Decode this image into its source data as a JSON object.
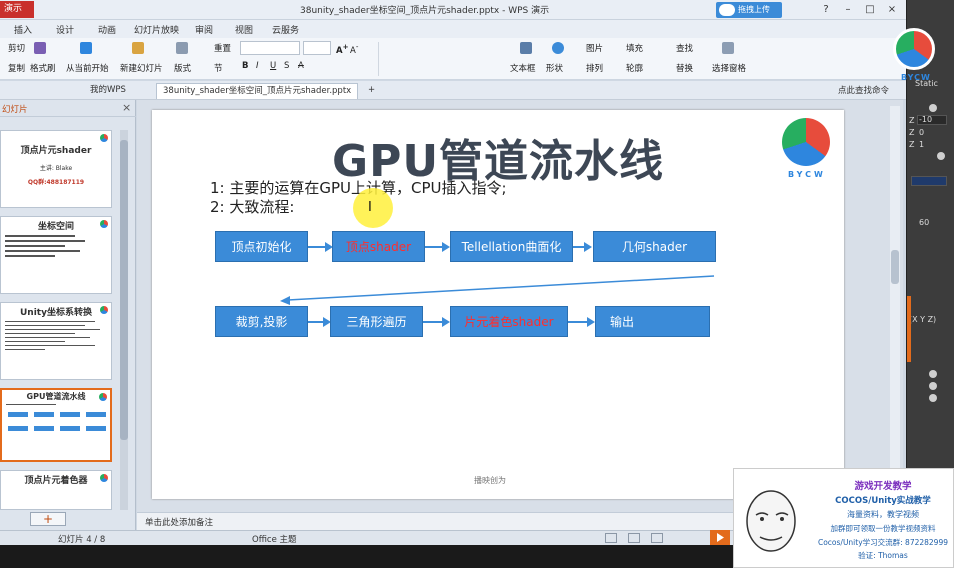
{
  "window": {
    "app_badge": "演示",
    "title": "38unity_shader坐标空间_顶点片元shader.pptx - WPS 演示",
    "upload_label": "拖拽上传",
    "controls": [
      "?",
      "–",
      "□",
      "×"
    ]
  },
  "menu": {
    "items": [
      "插入",
      "设计",
      "动画",
      "幻灯片放映",
      "审阅",
      "视图",
      "云服务"
    ]
  },
  "ribbon": {
    "cut": "剪切",
    "copy": "复制",
    "format_painter": "格式刷",
    "from_current": "从当前开始",
    "new_slide": "新建幻灯片",
    "layout": "版式",
    "section": "节",
    "reset": "重置",
    "text_box": "文本框",
    "shape": "形状",
    "picture": "图片",
    "fill": "填充",
    "arrange": "排列",
    "outline": "轮廓",
    "find": "查找",
    "replace": "替换",
    "select_pane": "选择窗格"
  },
  "tabs": {
    "my_wps": "我的WPS",
    "document": "38unity_shader坐标空间_顶点片元shader.pptx",
    "new_tab": "+",
    "search_cmd": "点此查找命令"
  },
  "left_panel": {
    "title": "幻灯片",
    "close": "×",
    "add_slide": "+",
    "thumbnails": [
      {
        "title": "顶点片元shader",
        "sub1": "主讲: Blake",
        "sub2": "QQ群:488187119"
      },
      {
        "title": "坐标空间"
      },
      {
        "title": "Unity坐标系转换"
      },
      {
        "title": "GPU管道流水线"
      },
      {
        "title": "顶点片元着色器"
      }
    ]
  },
  "slide": {
    "title": "GPU管道流水线",
    "logo_text": "BYCW",
    "bullets": [
      "1: 主要的运算在GPU上计算，CPU插入指令;",
      "2: 大致流程:"
    ],
    "row1": [
      "顶点初始化",
      "顶点shader",
      "Tellellation曲面化",
      "几何shader"
    ],
    "row2": [
      "裁剪,投影",
      "三角形遍历",
      "片元着色shader",
      "输出"
    ],
    "cursor": "I",
    "footer": "播映创为"
  },
  "notes": {
    "placeholder": "单击此处添加备注"
  },
  "status": {
    "slide_counter": "幻灯片 4 / 8",
    "theme": "Office 主题"
  },
  "right_panel": {
    "static_label": "Static",
    "z1": "Z",
    "z1_val": "-10",
    "z2": "Z",
    "z2_val": "0",
    "z3": "Z",
    "z3_val": "1",
    "val60": "60",
    "rotation": "(X Y Z)",
    "bycw": "BYCW"
  },
  "ad": {
    "title": "游戏开发教学",
    "subtitle": "COCOS/Unity实战教学",
    "line1": "海量资料，教学视频",
    "line2": "加群即可领取一份教学视频资料",
    "line3": "Cocos/Unity学习交流群: 872282999",
    "line4": "验证: Thomas"
  },
  "colors": {
    "flow_blue": "#3b8bd8",
    "flow_red_text": "#ff2d2d",
    "title_gray": "#3d4755",
    "wps_red": "#c9302c",
    "accent_orange": "#e36b1c"
  }
}
